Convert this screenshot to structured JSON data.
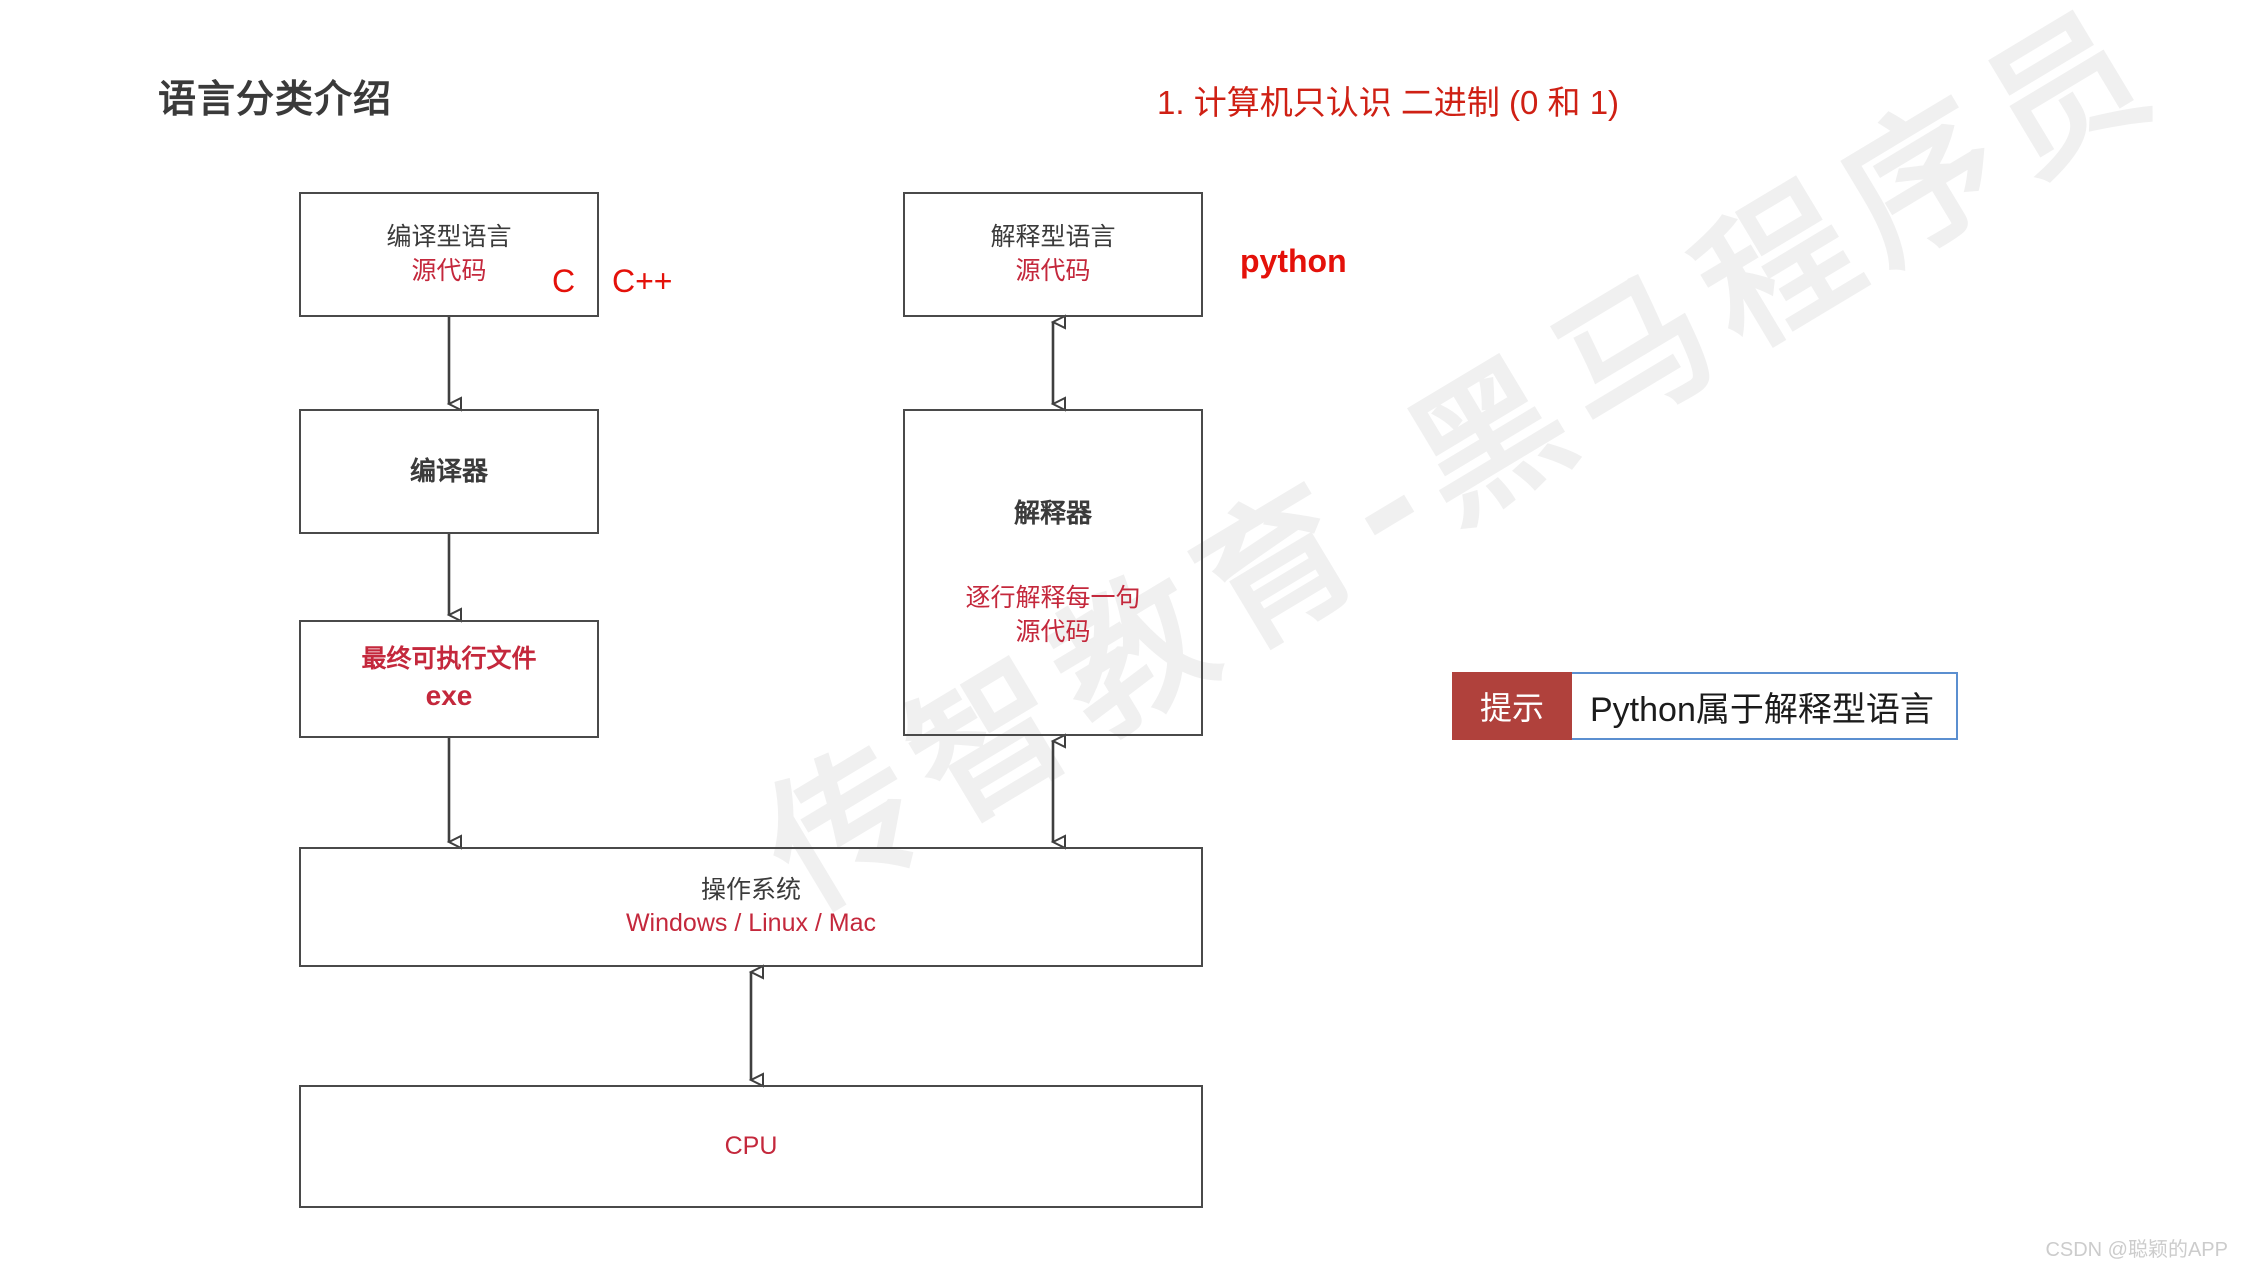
{
  "page": {
    "title": "语言分类介绍",
    "red_note": "1. 计算机只认识 二进制 (0 和 1)",
    "watermark": "传智教育-黑马程序员",
    "footer_watermark": "CSDN @聪颖的APP",
    "colors": {
      "title": "#3a3a3a",
      "note_red": "#cf2014",
      "box_text_dark": "#3b3b3b",
      "box_text_red": "#c4283c",
      "annotation_red": "#e4110a",
      "box_border": "#4a4a4a",
      "tip_label_bg": "#b0413c",
      "tip_body_border": "#5b8fd0",
      "background": "#ffffff"
    }
  },
  "diagram": {
    "type": "flowchart",
    "boxes": {
      "compiled_source": {
        "line1": "编译型语言",
        "line2": "源代码"
      },
      "compiler": {
        "line1": "编译器"
      },
      "executable": {
        "line1": "最终可执行文件",
        "line2": "exe"
      },
      "interpreted_source": {
        "line1": "解释型语言",
        "line2": "源代码"
      },
      "interpreter": {
        "line1": "解释器",
        "line2": "逐行解释每一句",
        "line3": "源代码"
      },
      "operating_system": {
        "line1": "操作系统",
        "line2": "Windows / Linux / Mac"
      },
      "cpu": {
        "line1": "CPU"
      }
    },
    "annotations": {
      "c": "C",
      "cpp": "C++",
      "python": "python"
    },
    "edges": [
      {
        "from": "compiled_source",
        "to": "compiler",
        "direction": "down"
      },
      {
        "from": "compiler",
        "to": "executable",
        "direction": "down"
      },
      {
        "from": "executable",
        "to": "operating_system",
        "direction": "down"
      },
      {
        "from": "interpreted_source",
        "to": "interpreter",
        "direction": "both"
      },
      {
        "from": "interpreter",
        "to": "operating_system",
        "direction": "both"
      },
      {
        "from": "operating_system",
        "to": "cpu",
        "direction": "both"
      }
    ]
  },
  "tip": {
    "label": "提示",
    "text": "Python属于解释型语言"
  }
}
